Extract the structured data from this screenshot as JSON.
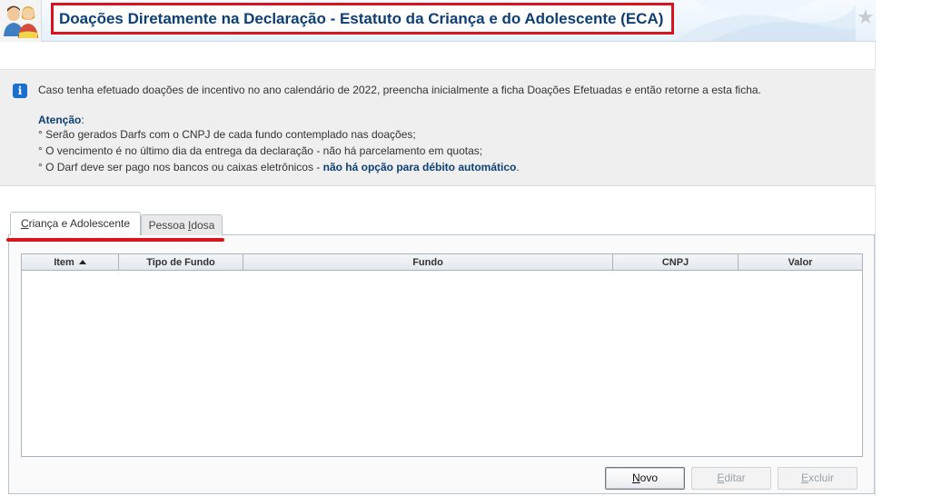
{
  "header": {
    "title": "Doações Diretamente na Declaração - Estatuto da Criança e do Adolescente (ECA)",
    "avatar_icon": "users-avatar-icon",
    "favorite_icon": "star-icon"
  },
  "info": {
    "icon": "info-icon",
    "message": "Caso tenha efetuado doações de incentivo no ano calendário de 2022, preencha inicialmente a ficha Doações Efetuadas e então retorne a esta ficha.",
    "attention_label": "Atenção",
    "attention_colon": ":",
    "bullets": [
      "° Serão gerados Darfs com o CNPJ de cada fundo contemplado nas doações;",
      "° O vencimento é no último dia da entrega da declaração - não há parcelamento em quotas;"
    ],
    "bullet3_text": "° O Darf deve ser pago nos bancos ou caixas eletrônicos - ",
    "bullet3_bold": "não há opção para débito automático",
    "bullet3_end": "."
  },
  "tabs": {
    "crianca_first": "C",
    "crianca_rest": "riança e Adolescente",
    "idosa_before": "Pessoa ",
    "idosa_underlined": "I",
    "idosa_after": "dosa"
  },
  "table": {
    "columns": [
      "Item",
      "Tipo de Fundo",
      "Fundo",
      "CNPJ",
      "Valor"
    ],
    "sort_icon": "sort-ascending-icon",
    "rows": []
  },
  "buttons": {
    "novo_first": "N",
    "novo_rest": "ovo",
    "editar_first": "E",
    "editar_rest": "ditar",
    "excluir_first": "E",
    "excluir_rest": "xcluir"
  },
  "colors": {
    "accent_red": "#d9141e",
    "title_blue": "#0d3f73",
    "info_blue": "#1a6fcf"
  }
}
